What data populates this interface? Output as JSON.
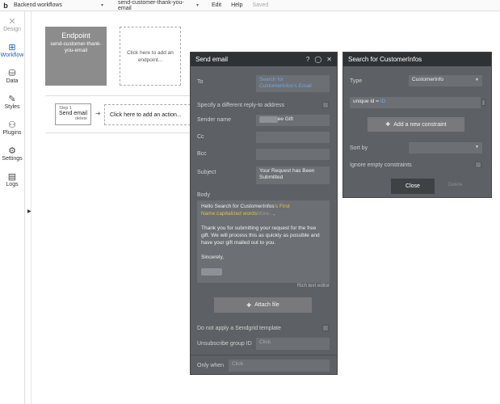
{
  "topbar": {
    "logo": "b",
    "page_name": "Backend workflows",
    "workflow_name": "send-customer-thank-you-email",
    "menu_edit": "Edit",
    "menu_help": "Help",
    "status": "Saved"
  },
  "sidebar": {
    "items": [
      {
        "label": "Design",
        "icon": "design-icon",
        "glyph": "✕"
      },
      {
        "label": "Workflow",
        "icon": "workflow-icon",
        "glyph": "⊞"
      },
      {
        "label": "Data",
        "icon": "data-icon",
        "glyph": "⛁"
      },
      {
        "label": "Styles",
        "icon": "styles-icon",
        "glyph": "✎"
      },
      {
        "label": "Plugins",
        "icon": "plugins-icon",
        "glyph": "⚇"
      },
      {
        "label": "Settings",
        "icon": "settings-icon",
        "glyph": "⚙"
      },
      {
        "label": "Logs",
        "icon": "logs-icon",
        "glyph": "▤"
      }
    ]
  },
  "canvas": {
    "endpoint_title": "Endpoint",
    "endpoint_name": "send-customer-thank-you-email",
    "add_endpoint": "Click here to add an endpoint...",
    "step_number": "Step 1",
    "step_name": "Send email",
    "step_delete": "delete",
    "add_action": "Click here to add an action..."
  },
  "send_email": {
    "title": "Send email",
    "to_label": "To",
    "to_value_prefix": "Search for",
    "to_value_suffix": "CustomerInfos's Email",
    "reply_to_label": "Specify a different reply-to address",
    "sender_name_label": "Sender name",
    "sender_name_blurred": "xxxxxxx",
    "sender_name_suffix": "ee Gift",
    "cc_label": "Cc",
    "bcc_label": "Bcc",
    "subject_label": "Subject",
    "subject_value": "Your Request has Been Submitted",
    "body_label": "Body",
    "body_greeting": "Hello Search for CustomerInfos",
    "body_dynamic": "'s First Name:capitalized words",
    "body_more": "More...",
    "body_comma": ",",
    "body_paragraph": "Thank you for submitting your request for the free gift. We will process this as quickly as possible and have your gift mailed out to you.",
    "body_closing": "Sincerely,",
    "body_signature_blurred": "xxxxxxxx",
    "rich_text_editor": "Rich text editor",
    "attach_file": "Attach file",
    "sendgrid_label": "Do not apply a Sendgrid template",
    "unsubscribe_label": "Unsubscribe group ID",
    "unsubscribe_placeholder": "Click",
    "only_when_label": "Only when",
    "only_when_placeholder": "Click"
  },
  "search_panel": {
    "title": "Search for CustomerInfos",
    "type_label": "Type",
    "type_value": "CustomerInfo",
    "constraint_field": "unique id =",
    "constraint_value": "ID",
    "add_constraint": "Add a new constraint",
    "sort_by_label": "Sort by",
    "ignore_empty_label": "Ignore empty constraints",
    "close_button": "Close",
    "delete_button": "Delete"
  }
}
